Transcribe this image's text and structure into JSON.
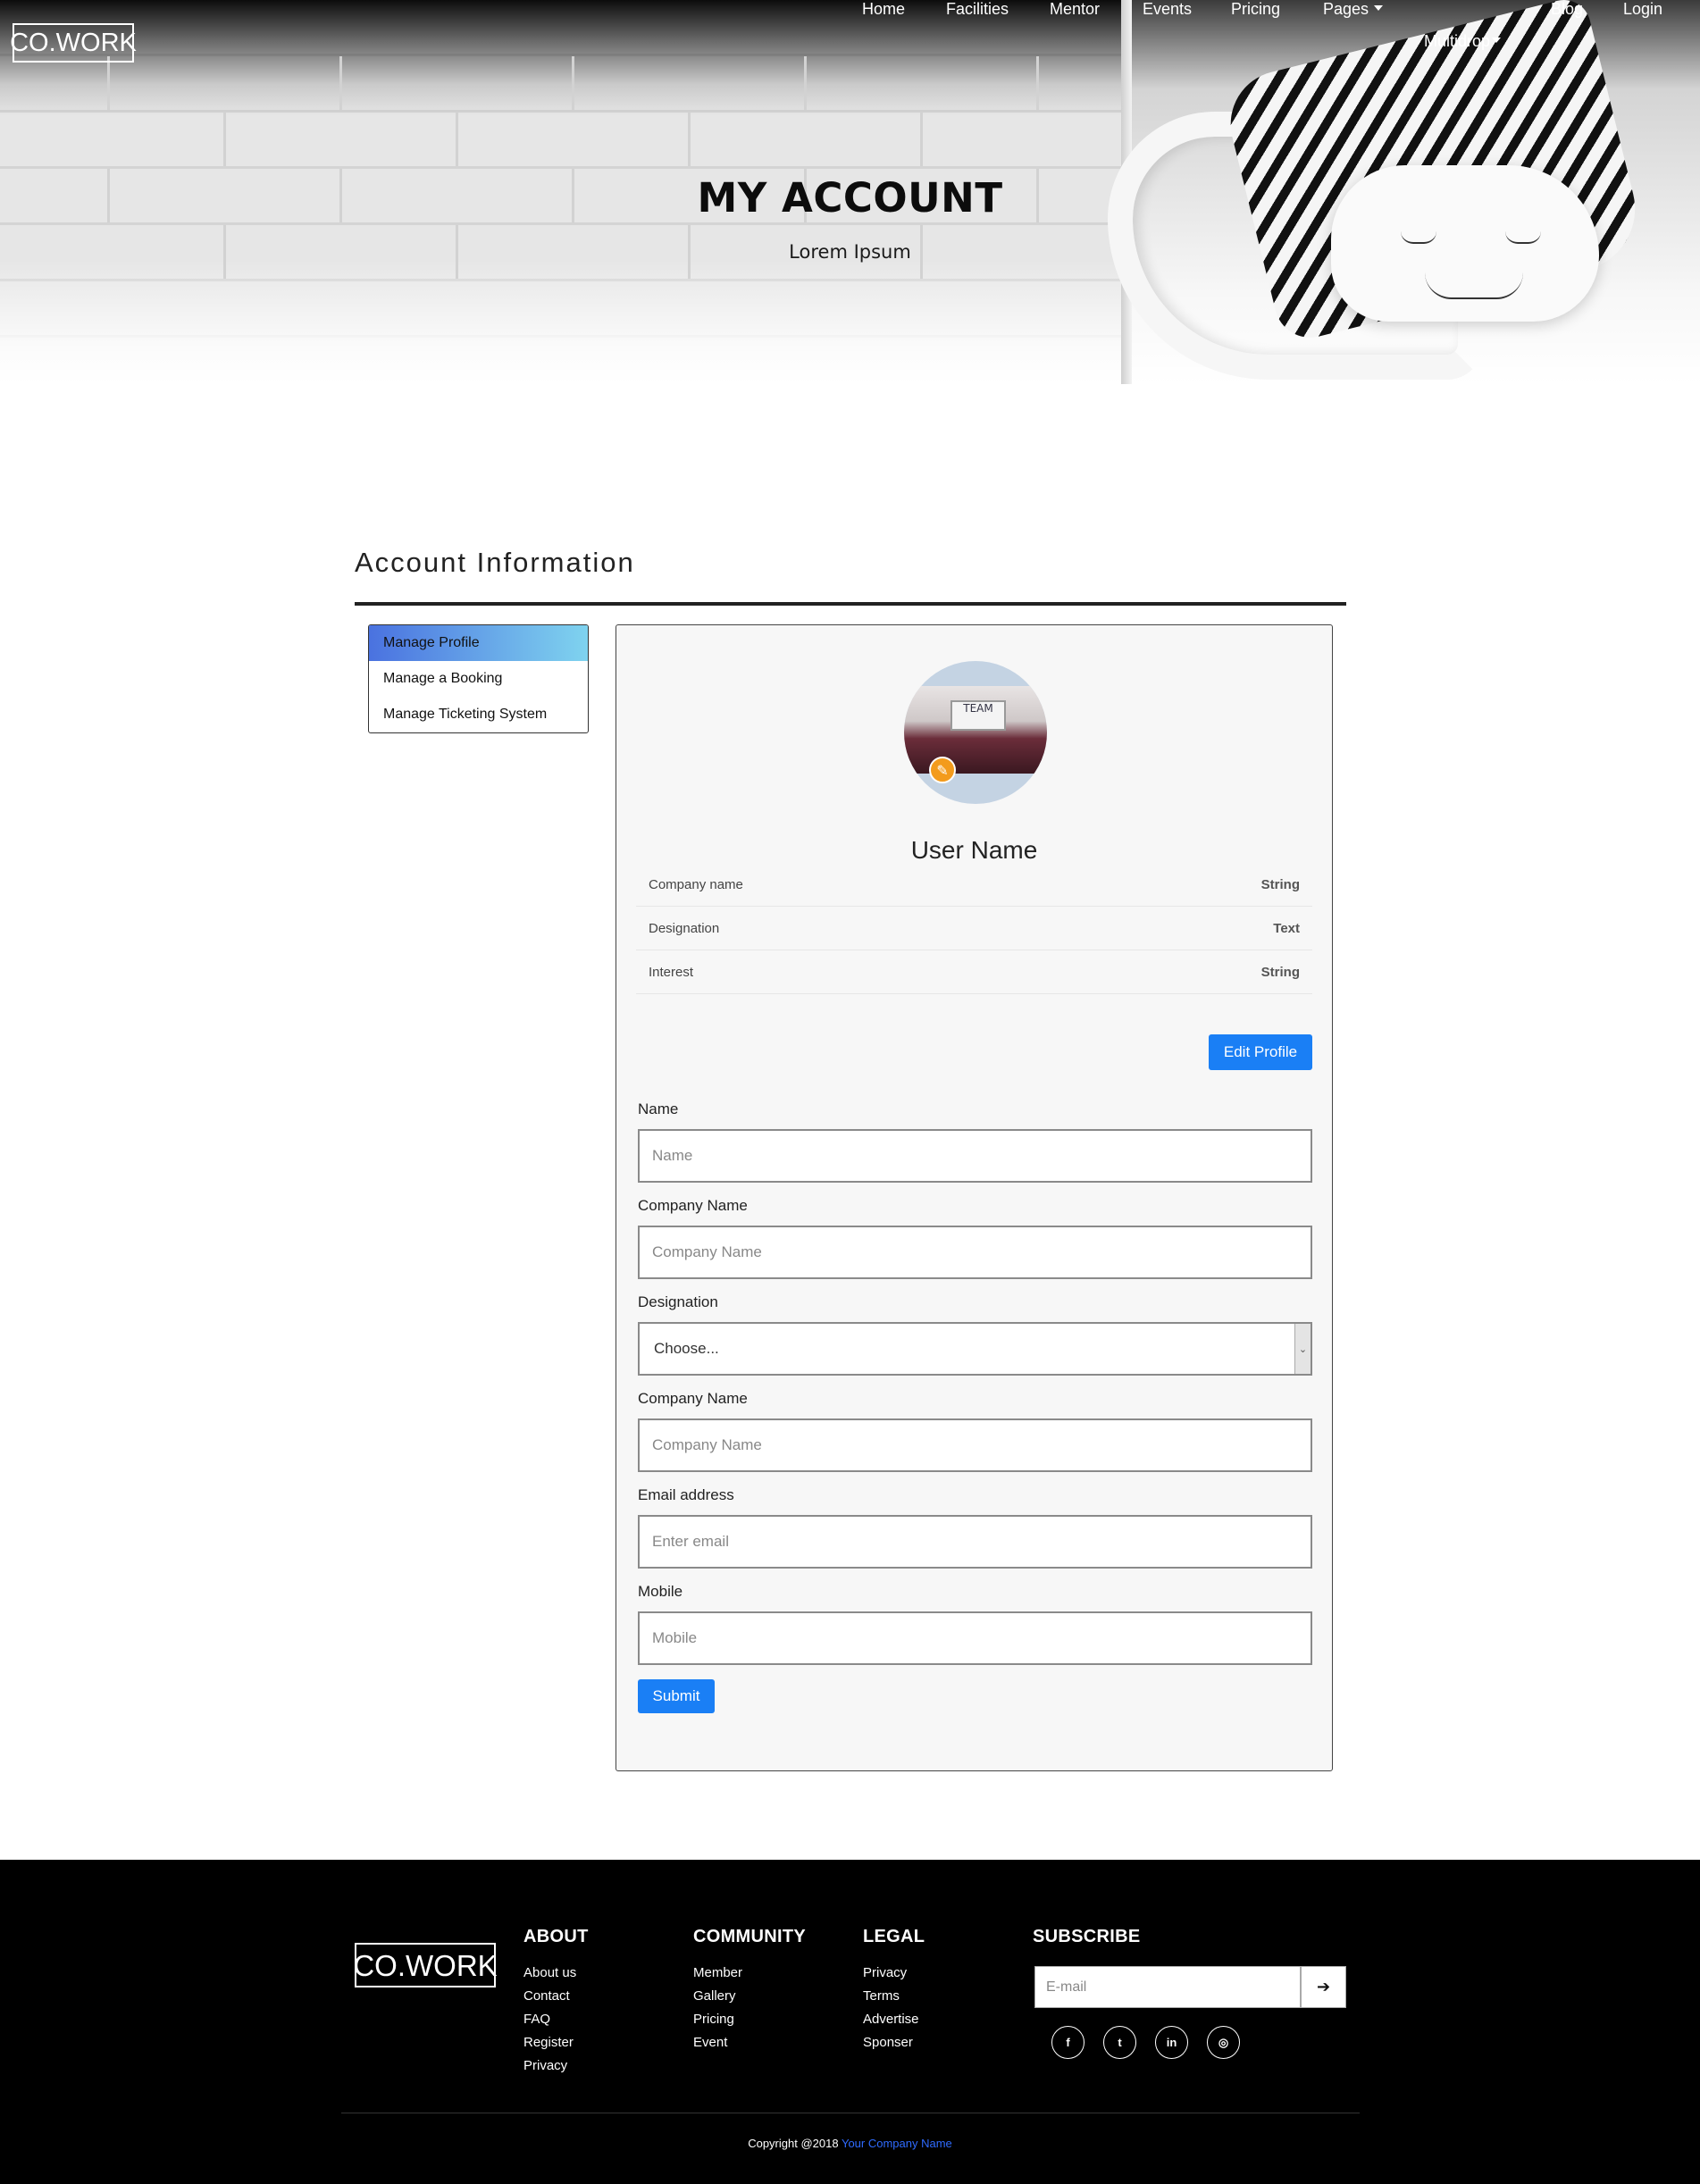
{
  "brand": {
    "logo_text": "CO.WORK"
  },
  "nav": {
    "items": [
      {
        "label": "Home"
      },
      {
        "label": "Facilities"
      },
      {
        "label": "Mentor"
      },
      {
        "label": "Events"
      },
      {
        "label": "Pricing"
      },
      {
        "label": "Pages"
      },
      {
        "label": "Multidrop"
      },
      {
        "label": "Blog"
      },
      {
        "label": "Login"
      }
    ]
  },
  "hero": {
    "title": "MY ACCOUNT",
    "subtitle": "Lorem Ipsum"
  },
  "account": {
    "title": "Account Information",
    "side_menu": [
      {
        "label": "Manage Profile",
        "active": true
      },
      {
        "label": "Manage a Booking",
        "active": false
      },
      {
        "label": "Manage Ticketing System",
        "active": false
      }
    ],
    "profile": {
      "avatar_board_text": "TEAM",
      "user_name": "User Name",
      "details": [
        {
          "label": "Company name",
          "value": "String"
        },
        {
          "label": "Designation",
          "value": "Text"
        },
        {
          "label": "Interest",
          "value": "String"
        }
      ],
      "edit_button": "Edit Profile"
    },
    "form": {
      "name": {
        "label": "Name",
        "placeholder": "Name"
      },
      "company": {
        "label": "Company Name",
        "placeholder": "Company Name"
      },
      "designation": {
        "label": "Designation",
        "selected": "Choose..."
      },
      "company2": {
        "label": "Company Name",
        "placeholder": "Company Name"
      },
      "email": {
        "label": "Email address",
        "placeholder": "Enter email"
      },
      "mobile": {
        "label": "Mobile",
        "placeholder": "Mobile"
      },
      "submit": "Submit"
    }
  },
  "footer": {
    "logo_text": "CO.WORK",
    "about": {
      "heading": "ABOUT",
      "links": [
        "About us",
        "Contact",
        "FAQ",
        "Register",
        "Privacy"
      ]
    },
    "community": {
      "heading": "COMMUNITY",
      "links": [
        "Member",
        "Gallery",
        "Pricing",
        "Event"
      ]
    },
    "legal": {
      "heading": "LEGAL",
      "links": [
        "Privacy",
        "Terms",
        "Advertise",
        "Sponser"
      ]
    },
    "subscribe": {
      "heading": "SUBSCRIBE",
      "placeholder": "E-mail",
      "button_icon": "arrow-right-icon"
    },
    "social": [
      {
        "icon": "facebook-icon",
        "glyph": "f"
      },
      {
        "icon": "twitter-icon",
        "glyph": "t"
      },
      {
        "icon": "linkedin-icon",
        "glyph": "in"
      },
      {
        "icon": "instagram-icon",
        "glyph": "◎"
      }
    ],
    "copyright_prefix": "Copyright @2018",
    "company_link": "Your Company Name"
  },
  "colors": {
    "primary_button": "#1a7ff5",
    "active_menu_start": "#4a72e0",
    "active_menu_end": "#7fd3ef",
    "edit_badge": "#f39b1c",
    "footer_bg": "#000000",
    "link_blue": "#2f6bff"
  }
}
